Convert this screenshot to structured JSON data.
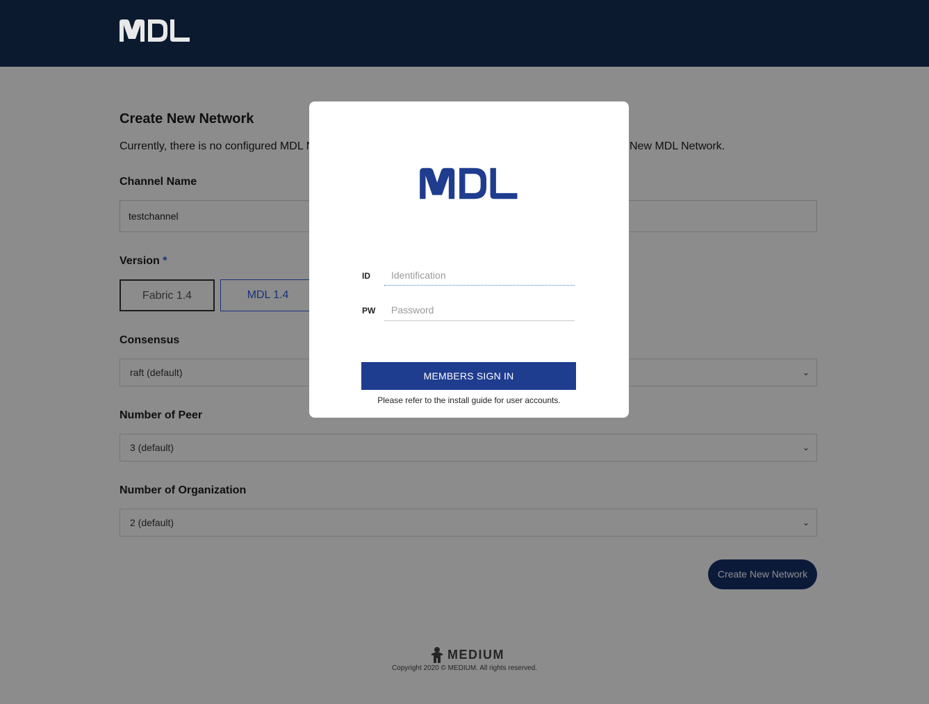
{
  "header": {
    "logo_text": "MDL"
  },
  "form": {
    "title": "Create New Network",
    "description_left": "Currently, there is no configured MDL N",
    "description_right": "New MDL Network.",
    "channel_name": {
      "label": "Channel Name",
      "value": "testchannel"
    },
    "version": {
      "label": "Version",
      "required_mark": "*",
      "options": [
        "Fabric 1.4",
        "MDL 1.4"
      ],
      "selected": "MDL 1.4"
    },
    "consensus": {
      "label": "Consensus",
      "value": "raft (default)"
    },
    "peers": {
      "label": "Number of Peer",
      "value": "3 (default)"
    },
    "organizations": {
      "label": "Number of Organization",
      "value": "2 (default)"
    },
    "submit_label": "Create New Network"
  },
  "footer": {
    "brand": "MEDIUM",
    "copyright": "Copyright 2020 © MEDIUM. All rights reserved."
  },
  "login_modal": {
    "logo_text": "MDL",
    "id_label": "ID",
    "id_placeholder": "Identification",
    "pw_label": "PW",
    "pw_placeholder": "Password",
    "signin_label": "MEMBERS SIGN IN",
    "hint": "Please refer to the install guide for user accounts."
  },
  "colors": {
    "header_bg": "#0b1a2f",
    "brand_blue": "#1f3d8f",
    "accent_blue": "#2a5bd7"
  }
}
